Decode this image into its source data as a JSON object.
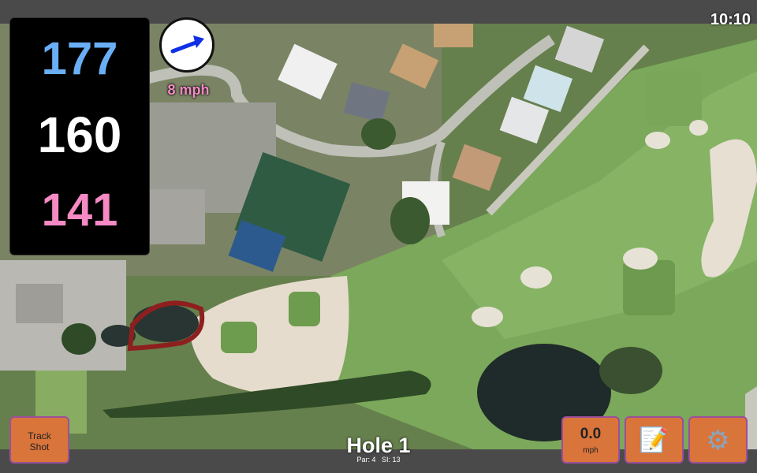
{
  "status": {
    "time": "10:10"
  },
  "distances": {
    "back": "177",
    "middle": "160",
    "front": "141"
  },
  "wind": {
    "speed_label": "8 mph"
  },
  "buttons": {
    "track_shot_line1": "Track",
    "track_shot_line2": "Shot",
    "wind_value": "0.0",
    "wind_unit": "mph",
    "notes_icon": "notepad-icon",
    "settings_icon": "gear-icon"
  },
  "hole": {
    "title": "Hole 1",
    "par": "Par: 4",
    "si": "SI: 13"
  },
  "colors": {
    "back": "#6aaef5",
    "middle": "#ffffff",
    "front": "#f58ac4",
    "wind_label": "#f58ac4",
    "wind_arrow": "#1030e6",
    "button": "#d9743a"
  }
}
